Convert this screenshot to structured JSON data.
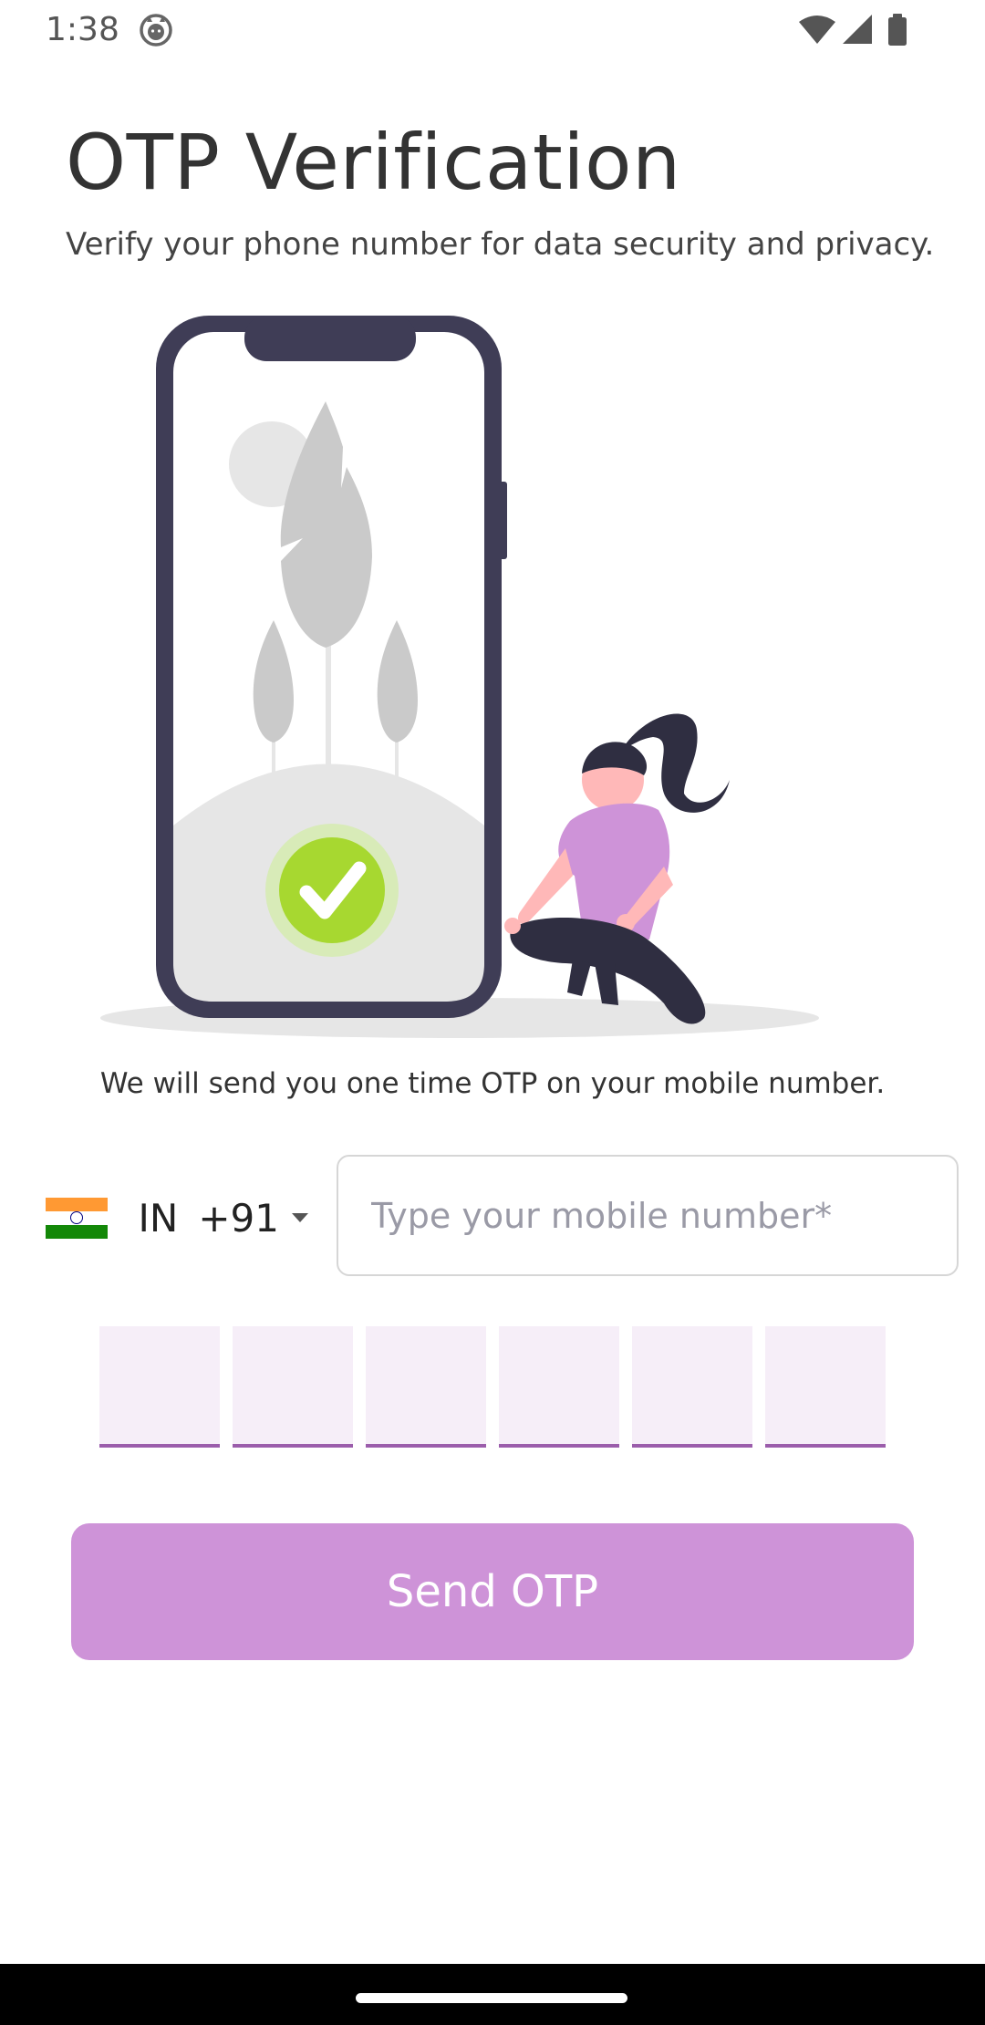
{
  "status_bar": {
    "time": "1:38",
    "icons": [
      "cat-icon",
      "wifi-icon",
      "cellular-signal-icon",
      "battery-icon"
    ]
  },
  "header": {
    "title": "OTP Verification",
    "subtitle": "Verify your phone number for data security and privacy."
  },
  "illustration": {
    "icon": "phone-verification-illustration",
    "colors": {
      "phone_frame": "#3F3D56",
      "screen": "#E6E6E6",
      "check": "#A7D830",
      "shirt": "#CE93D8"
    }
  },
  "info": {
    "text": "We will send you one time OTP on your mobile number."
  },
  "phone": {
    "country_code": "IN",
    "dial_code": "+91",
    "flag_icon": "india-flag-icon",
    "placeholder": "Type your mobile number*",
    "value": ""
  },
  "otp": {
    "length": 6,
    "digits": [
      "",
      "",
      "",
      "",
      "",
      ""
    ]
  },
  "actions": {
    "send_label": "Send OTP"
  },
  "theme": {
    "accent": "#CE93D8",
    "otp_underline": "#9B5DAB",
    "otp_fill": "#F6EEF8"
  }
}
